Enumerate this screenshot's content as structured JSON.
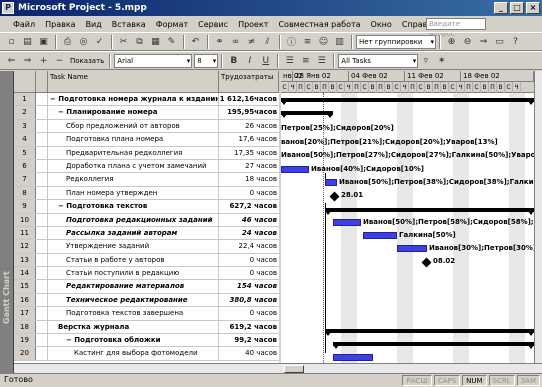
{
  "window": {
    "title": "Microsoft Project - 5.mpp"
  },
  "menu": [
    "Файл",
    "Правка",
    "Вид",
    "Вставка",
    "Формат",
    "Сервис",
    "Проект",
    "Совместная работа",
    "Окно",
    "Справка"
  ],
  "help_placeholder": "Введите вопрос",
  "toolbar1": {
    "group_select": "Нет группировки"
  },
  "toolbar2": {
    "show_label": "Показать",
    "font": "Arial",
    "size": "8",
    "filter": "All Tasks"
  },
  "sidebar": {
    "label": "Gantt Chart"
  },
  "grid": {
    "col_name": "Task Name",
    "col_work": "Трудозатраты",
    "rows": [
      {
        "id": "1",
        "name": "− Подготовка номера журнала к изданию",
        "work": "1 612,16часов",
        "level": 0,
        "style": "bold"
      },
      {
        "id": "2",
        "name": "− Планирование номера",
        "work": "195,95часов",
        "level": 1,
        "style": "bold"
      },
      {
        "id": "3",
        "name": "Сбор предложений от авторов",
        "work": "26 часов",
        "level": 2,
        "style": ""
      },
      {
        "id": "4",
        "name": "Подготовка плана номера",
        "work": "17,6 часов",
        "level": 2,
        "style": ""
      },
      {
        "id": "5",
        "name": "Предварительная редколлегия",
        "work": "17,35 часов",
        "level": 2,
        "style": ""
      },
      {
        "id": "6",
        "name": "Доработка плана с учетом замечаний",
        "work": "27 часов",
        "level": 2,
        "style": ""
      },
      {
        "id": "7",
        "name": "Редколлегия",
        "work": "18 часов",
        "level": 2,
        "style": ""
      },
      {
        "id": "8",
        "name": "План номера утвержден",
        "work": "0 часов",
        "level": 2,
        "style": ""
      },
      {
        "id": "9",
        "name": "− Подготовка текстов",
        "work": "627,2 часов",
        "level": 1,
        "style": "bold"
      },
      {
        "id": "10",
        "name": "Подготовка редакционных заданий",
        "work": "46 часов",
        "level": 2,
        "style": "bold italic"
      },
      {
        "id": "11",
        "name": "Рассылка заданий авторам",
        "work": "24 часов",
        "level": 2,
        "style": "bold italic"
      },
      {
        "id": "12",
        "name": "Утверждение заданий",
        "work": "22,4 часов",
        "level": 2,
        "style": ""
      },
      {
        "id": "13",
        "name": "Статьи в работе у авторов",
        "work": "0 часов",
        "level": 2,
        "style": ""
      },
      {
        "id": "14",
        "name": "Статьи поступили в редакцию",
        "work": "0 часов",
        "level": 2,
        "style": ""
      },
      {
        "id": "15",
        "name": "Редактирование материалов",
        "work": "154 часов",
        "level": 2,
        "style": "bold italic"
      },
      {
        "id": "16",
        "name": "Техническое редактирование",
        "work": "380,8 часов",
        "level": 2,
        "style": "bold italic"
      },
      {
        "id": "17",
        "name": "Подготовка текстов завершена",
        "work": "0 часов",
        "level": 2,
        "style": ""
      },
      {
        "id": "18",
        "name": "Верстка журнала",
        "work": "619,2 часов",
        "level": 1,
        "style": "bold"
      },
      {
        "id": "19",
        "name": "− Подготовка обложки",
        "work": "99,2 часов",
        "level": 2,
        "style": "bold"
      },
      {
        "id": "20",
        "name": "Кастинг для выбора фотомодели",
        "work": "40 часов",
        "level": 3,
        "style": ""
      }
    ]
  },
  "gantt": {
    "weeks": [
      "нв 02",
      "28 Янв 02",
      "04 Фев 02",
      "11 Фев 02",
      "18 Фев 02"
    ],
    "days": [
      "С",
      "Ч",
      "П",
      "С",
      "В",
      "П",
      "В",
      "С",
      "Ч",
      "П",
      "С",
      "В",
      "П",
      "В",
      "С",
      "Ч",
      "П",
      "С",
      "В",
      "П",
      "В",
      "С",
      "Ч",
      "П",
      "С",
      "В",
      "П",
      "В",
      "С",
      "Ч"
    ],
    "labels": [
      {
        "row": 3,
        "text": "Петров[25%];Сидоров[20%]"
      },
      {
        "row": 4,
        "text": "ванов[20%];Петров[21%];Сидоров[20%];Уваров[13%]"
      },
      {
        "row": 5,
        "text": "Иванов[50%];Петров[27%];Сидоров[27%];Галкина[50%];Уваров[13"
      },
      {
        "row": 6,
        "text": "Иванов[40%];Сидоров[10%]"
      },
      {
        "row": 7,
        "text": "Иванов[50%];Петров[38%];Сидоров[38%];Галкина[50"
      },
      {
        "row": 8,
        "text": "28.01"
      },
      {
        "row": 10,
        "text": "Иванов[50%];Петров[58%];Сидоров[58%];Гал"
      },
      {
        "row": 11,
        "text": "Галкина[50%]"
      },
      {
        "row": 12,
        "text": "Иванов[30%];Петров[30%];С"
      },
      {
        "row": 13,
        "text": "08.02"
      }
    ]
  },
  "status": {
    "text": "Готово",
    "flags": [
      {
        "label": "РАСШ",
        "on": false
      },
      {
        "label": "CAPS",
        "on": false
      },
      {
        "label": "NUM",
        "on": true
      },
      {
        "label": "SCRL",
        "on": false
      },
      {
        "label": "ЗАМ",
        "on": false
      }
    ]
  }
}
